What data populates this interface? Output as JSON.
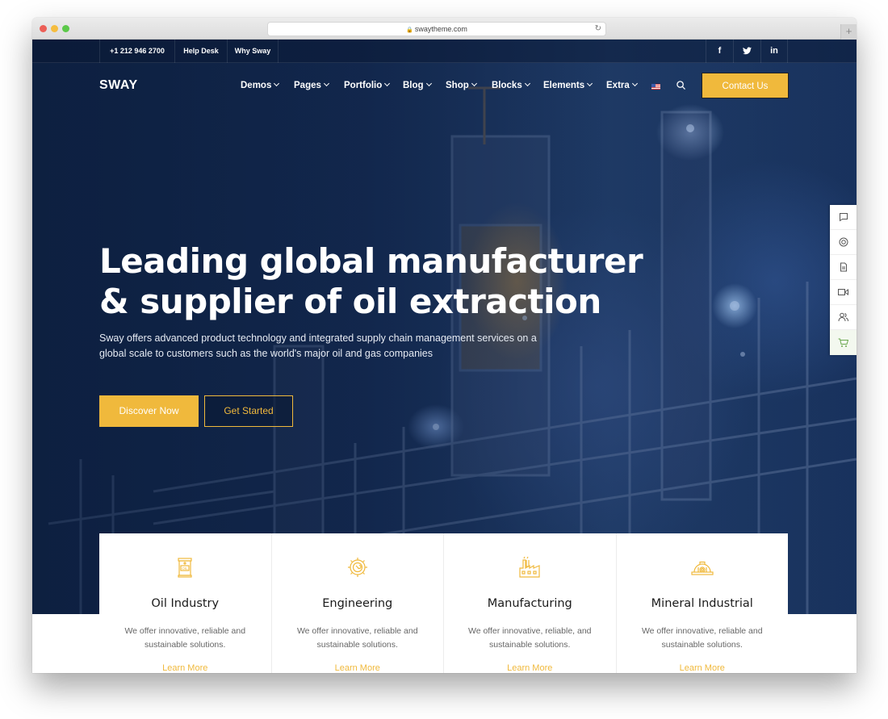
{
  "browser": {
    "url": "swaytheme.com"
  },
  "topbar": {
    "phone": "+1 212 946 2700",
    "links": [
      "Help Desk",
      "Why Sway"
    ],
    "social": [
      {
        "icon": "facebook-icon",
        "glyph": "f"
      },
      {
        "icon": "twitter-icon",
        "glyph": "t"
      },
      {
        "icon": "linkedin-icon",
        "glyph": "in"
      }
    ]
  },
  "header": {
    "logo": "SWAY",
    "nav": [
      "Demos",
      "Pages",
      "Portfolio",
      "Blog",
      "Shop",
      "Blocks",
      "Elements",
      "Extra"
    ],
    "language_icon": "us-flag-icon",
    "contact_label": "Contact Us"
  },
  "hero": {
    "headline_line1": "Leading global manufacturer",
    "headline_line2": "& supplier of oil extraction",
    "subtext": "Sway offers advanced product technology and integrated supply chain management services on a global scale to customers such as the world's major oil and gas companies",
    "primary_cta": "Discover Now",
    "secondary_cta": "Get Started"
  },
  "side_tools": [
    "chat-icon",
    "support-icon",
    "document-icon",
    "video-icon",
    "users-icon",
    "cart-icon"
  ],
  "services": [
    {
      "icon": "oil-barrel-icon",
      "title": "Oil Industry",
      "desc": "We offer innovative, reliable and sustainable solutions.",
      "link": "Learn More"
    },
    {
      "icon": "gear-icon",
      "title": "Engineering",
      "desc": "We offer innovative, reliable and sustainable solutions.",
      "link": "Learn More"
    },
    {
      "icon": "factory-icon",
      "title": "Manufacturing",
      "desc": "We offer innovative, reliable, and sustainable solutions.",
      "link": "Learn More"
    },
    {
      "icon": "hard-hat-icon",
      "title": "Mineral Industrial",
      "desc": "We offer innovative, reliable and sustainable solutions.",
      "link": "Learn More"
    }
  ],
  "colors": {
    "accent": "#f0b93c",
    "hero_dark": "#0f2448"
  }
}
